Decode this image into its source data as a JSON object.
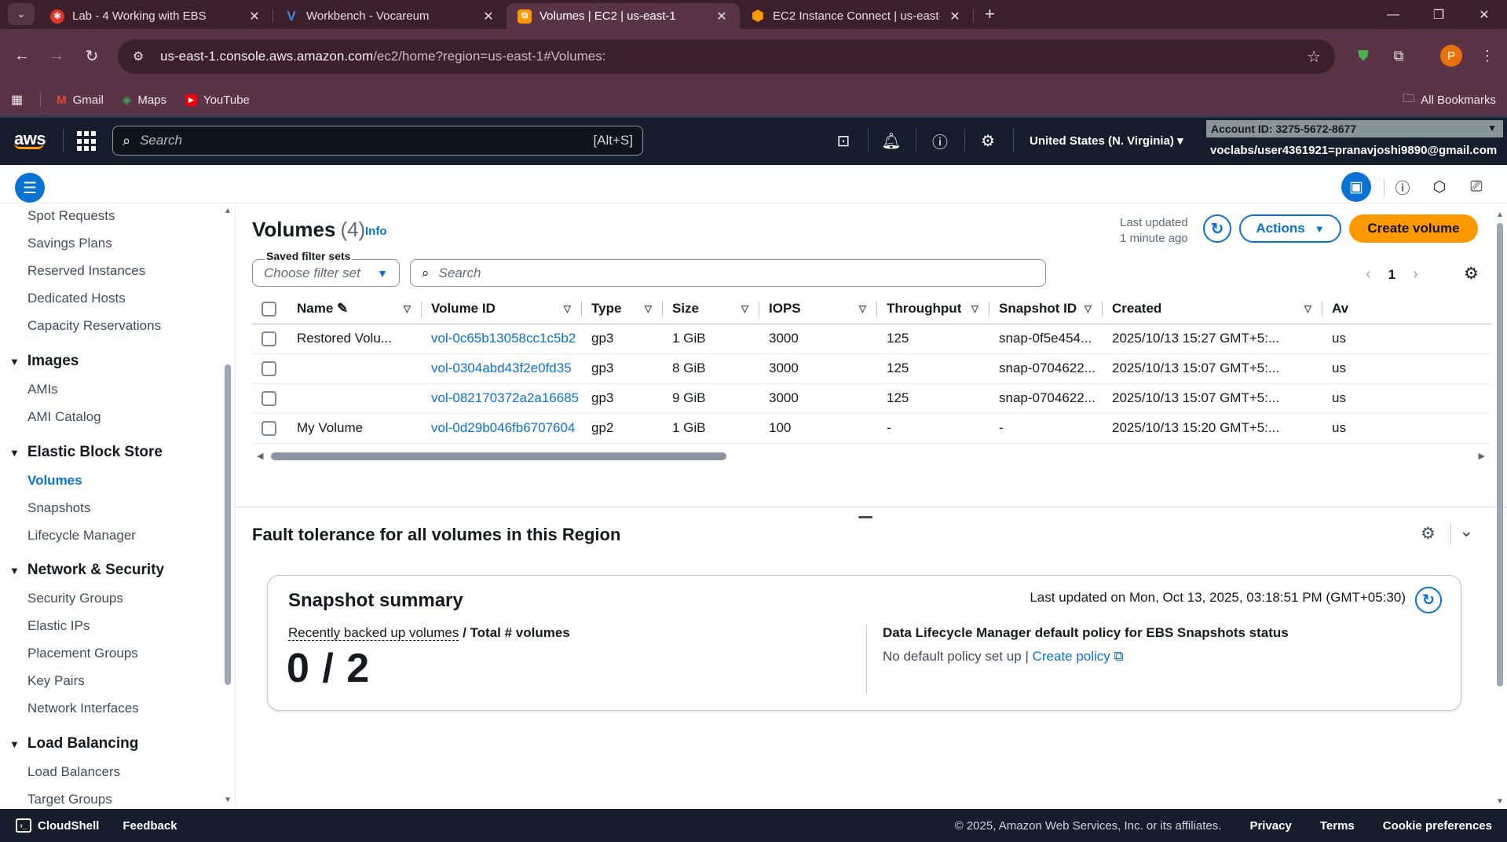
{
  "browser": {
    "tabs": [
      {
        "title": "Lab - 4 Working with EBS",
        "icon": "lab-icon",
        "icon_color": "#e0362c",
        "active": false
      },
      {
        "title": "Workbench - Vocareum",
        "icon": "vocareum-icon",
        "icon_color": "#3a8dde",
        "active": false
      },
      {
        "title": "Volumes | EC2 | us-east-1",
        "icon": "ec2-icon",
        "icon_color": "#ff9900",
        "active": true
      },
      {
        "title": "EC2 Instance Connect | us-east-",
        "icon": "ec2-connect-icon",
        "icon_color": "#ff9900",
        "active": false
      }
    ],
    "url_host": "us-east-1.console.aws.amazon.com",
    "url_path": "/ec2/home?region=us-east-1#Volumes:",
    "profile_initial": "P",
    "bookmarks": [
      {
        "label": "Gmail",
        "icon": "gmail-icon"
      },
      {
        "label": "Maps",
        "icon": "maps-icon"
      },
      {
        "label": "YouTube",
        "icon": "youtube-icon"
      }
    ],
    "all_bookmarks": "All Bookmarks"
  },
  "aws_nav": {
    "logo": "aws",
    "search_placeholder": "Search",
    "search_shortcut": "[Alt+S]",
    "region": "United States (N. Virginia)",
    "account": "Account ID: 3275-5672-8677",
    "user": "voclabs/user4361921=pranavjoshi9890@gmail.com"
  },
  "sidebar": {
    "items": [
      {
        "type": "item",
        "label": "Spot Requests"
      },
      {
        "type": "item",
        "label": "Savings Plans"
      },
      {
        "type": "item",
        "label": "Reserved Instances"
      },
      {
        "type": "item",
        "label": "Dedicated Hosts"
      },
      {
        "type": "item",
        "label": "Capacity Reservations"
      },
      {
        "type": "head",
        "label": "Images"
      },
      {
        "type": "item",
        "label": "AMIs"
      },
      {
        "type": "item",
        "label": "AMI Catalog"
      },
      {
        "type": "head",
        "label": "Elastic Block Store"
      },
      {
        "type": "item",
        "label": "Volumes",
        "active": true
      },
      {
        "type": "item",
        "label": "Snapshots"
      },
      {
        "type": "item",
        "label": "Lifecycle Manager"
      },
      {
        "type": "head",
        "label": "Network & Security"
      },
      {
        "type": "item",
        "label": "Security Groups"
      },
      {
        "type": "item",
        "label": "Elastic IPs"
      },
      {
        "type": "item",
        "label": "Placement Groups"
      },
      {
        "type": "item",
        "label": "Key Pairs"
      },
      {
        "type": "item",
        "label": "Network Interfaces"
      },
      {
        "type": "head",
        "label": "Load Balancing"
      },
      {
        "type": "item",
        "label": "Load Balancers"
      },
      {
        "type": "item",
        "label": "Target Groups"
      }
    ]
  },
  "main": {
    "title": "Volumes",
    "count": "(4)",
    "info": "Info",
    "last_updated_1": "Last updated",
    "last_updated_2": "1 minute ago",
    "actions": "Actions",
    "create": "Create volume",
    "filter_label": "Saved filter sets",
    "filter_placeholder": "Choose filter set",
    "search_placeholder": "Search",
    "page": "1",
    "columns": [
      "Name",
      "Volume ID",
      "Type",
      "Size",
      "IOPS",
      "Throughput",
      "Snapshot ID",
      "Created",
      "Av"
    ],
    "rows": [
      [
        "Restored Volu...",
        "vol-0c65b13058cc1c5b2",
        "gp3",
        "1 GiB",
        "3000",
        "125",
        "snap-0f5e454...",
        "2025/10/13 15:27 GMT+5:...",
        "us"
      ],
      [
        "",
        "vol-0304abd43f2e0fd35",
        "gp3",
        "8 GiB",
        "3000",
        "125",
        "snap-0704622...",
        "2025/10/13 15:07 GMT+5:...",
        "us"
      ],
      [
        "",
        "vol-082170372a2a16685",
        "gp3",
        "9 GiB",
        "3000",
        "125",
        "snap-0704622...",
        "2025/10/13 15:07 GMT+5:...",
        "us"
      ],
      [
        "My Volume",
        "vol-0d29b046fb6707604",
        "gp2",
        "1 GiB",
        "100",
        "-",
        "-",
        "2025/10/13 15:20 GMT+5:...",
        "us"
      ]
    ]
  },
  "fault": {
    "title": "Fault tolerance for all volumes in this Region",
    "snapshot_title": "Snapshot summary",
    "last_updated": "Last updated on Mon, Oct 13, 2025, 03:18:51 PM (GMT+05:30)",
    "metric_label_link": "Recently backed up volumes",
    "metric_label_rest": "/ Total # volumes",
    "metric_value": "0 / 2",
    "dlm_title": "Data Lifecycle Manager default policy for EBS Snapshots status",
    "dlm_text": "No default policy set up |",
    "dlm_link": "Create policy"
  },
  "footer": {
    "cloudshell": "CloudShell",
    "feedback": "Feedback",
    "copyright": "© 2025, Amazon Web Services, Inc. or its affiliates.",
    "privacy": "Privacy",
    "terms": "Terms",
    "cookies": "Cookie preferences"
  }
}
